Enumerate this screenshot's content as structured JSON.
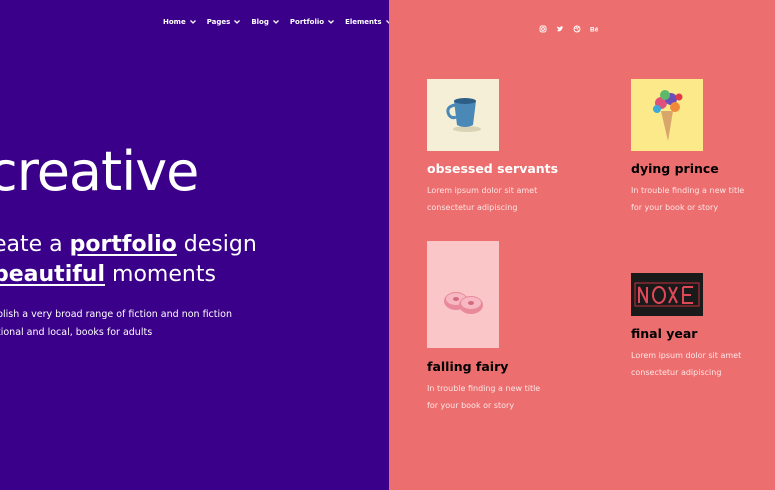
{
  "nav": {
    "items": [
      {
        "label": "Home"
      },
      {
        "label": "Pages"
      },
      {
        "label": "Blog"
      },
      {
        "label": "Portfolio"
      },
      {
        "label": "Elements"
      }
    ]
  },
  "hero": {
    "title": "creative",
    "tagline_prefix": "eate a",
    "tagline_link": "portfolio",
    "tagline_suffix": "design",
    "tagline2_link": "beautiful",
    "tagline2_suffix": "moments",
    "desc_line1": "blish a very broad range of fiction and non fiction",
    "desc_line2": "tional and local, books for adults"
  },
  "social": {
    "icons": [
      "instagram-icon",
      "twitter-icon",
      "dribbble-icon",
      "behance-icon"
    ]
  },
  "portfolio": {
    "items": [
      {
        "title": "obsessed servants",
        "line1": "Lorem ipsum dolor sit amet",
        "line2": "consectetur adipiscing",
        "thumb_color": "#f4efd6"
      },
      {
        "title": "dying prince",
        "line1": "In trouble finding a new title",
        "line2": "for your book or story",
        "thumb_color": "#fbe98a"
      },
      {
        "title": "falling fairy",
        "line1": "In trouble finding a new title",
        "line2": "for your book or story",
        "thumb_color": "#fbc6c8"
      },
      {
        "title": "final year",
        "line1": "Lorem ipsum dolor sit amet",
        "line2": "consectetur adipiscing",
        "thumb_color": "#1a1a1a"
      }
    ]
  },
  "colors": {
    "left_bg": "#3a008a",
    "right_bg": "#ec6e6e"
  }
}
